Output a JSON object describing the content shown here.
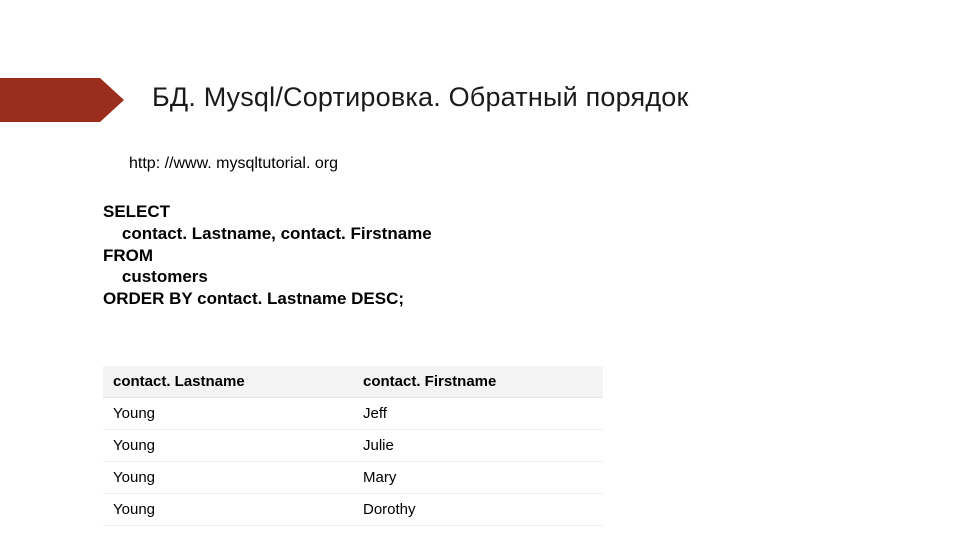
{
  "title": "БД. Mysql/Сортировка. Обратный порядок",
  "source": "http: //www. mysqltutorial. org",
  "code": "SELECT\n    contact. Lastname, contact. Firstname\nFROM\n    customers\nORDER BY contact. Lastname DESC;",
  "table": {
    "headers": [
      "contact. Lastname",
      "contact. Firstname"
    ],
    "rows": [
      [
        "Young",
        "Jeff"
      ],
      [
        "Young",
        "Julie"
      ],
      [
        "Young",
        "Mary"
      ],
      [
        "Young",
        "Dorothy"
      ]
    ]
  },
  "chart_data": {
    "type": "table",
    "title": "БД. Mysql/Сортировка. Обратный порядок",
    "columns": [
      "contact.Lastname",
      "contact.Firstname"
    ],
    "rows": [
      [
        "Young",
        "Jeff"
      ],
      [
        "Young",
        "Julie"
      ],
      [
        "Young",
        "Mary"
      ],
      [
        "Young",
        "Dorothy"
      ]
    ]
  }
}
